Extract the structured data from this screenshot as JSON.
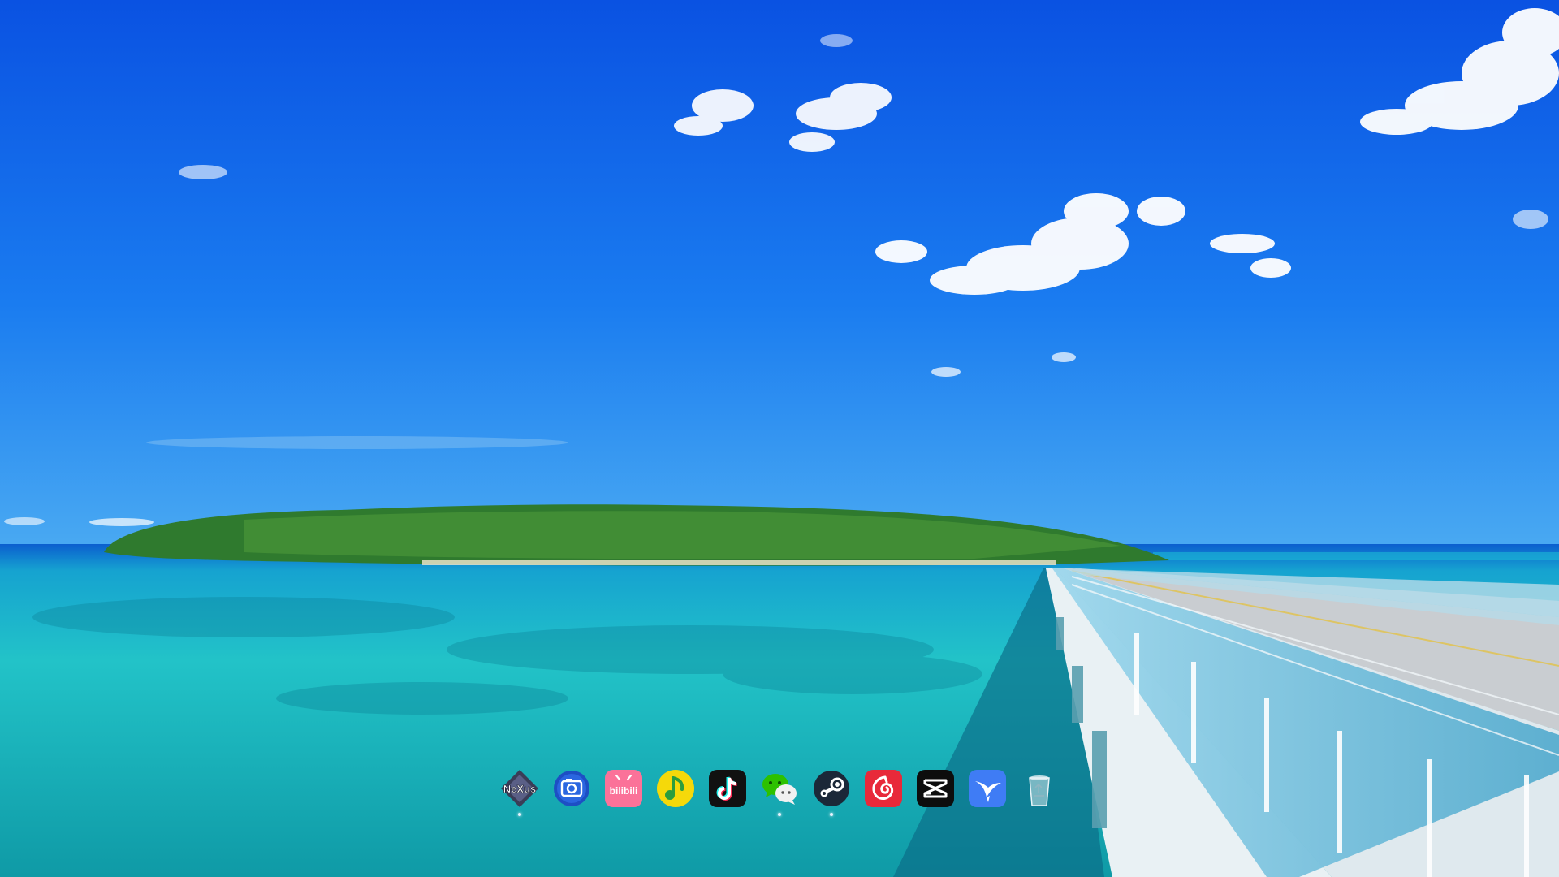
{
  "wallpaper": {
    "description_icon": "ocean-bridge-wallpaper",
    "colors": {
      "sky_top": "#0a57e6",
      "sky_mid": "#1a7cf0",
      "sky_horizon": "#4aa8f0",
      "sea_far": "#0d63c9",
      "sea_mid": "#1ab9c6",
      "sea_near": "#0e9fab",
      "island": "#2e7d32",
      "bridge_rail": "#5ab4d6",
      "road": "#c9ccd0"
    }
  },
  "dock": {
    "items": [
      {
        "name": "winstep-nexus",
        "icon": "nexus-icon",
        "logo_text": "NeXus",
        "running": true
      },
      {
        "name": "screenshot-tool",
        "icon": "camera-icon",
        "running": false
      },
      {
        "name": "bilibili",
        "icon": "bilibili-icon",
        "logo_text": "bilibili",
        "running": false
      },
      {
        "name": "qq-music",
        "icon": "music-note-icon",
        "running": false
      },
      {
        "name": "tiktok",
        "icon": "tiktok-icon",
        "running": false
      },
      {
        "name": "wechat",
        "icon": "wechat-icon",
        "running": true
      },
      {
        "name": "steam",
        "icon": "steam-icon",
        "running": true
      },
      {
        "name": "netease-cloud-music",
        "icon": "netease-music-icon",
        "running": false
      },
      {
        "name": "capcut",
        "icon": "capcut-icon",
        "running": false
      },
      {
        "name": "feishu-lark",
        "icon": "bird-icon",
        "running": false
      },
      {
        "name": "recycle-bin",
        "icon": "recycle-bin-icon",
        "running": false
      }
    ]
  }
}
